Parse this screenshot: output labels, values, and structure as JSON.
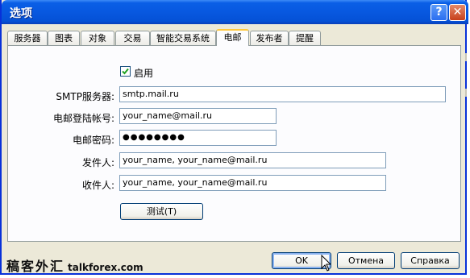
{
  "window": {
    "title": "选项",
    "help_label": "?",
    "close_label": "✕"
  },
  "tabs": [
    {
      "label": "服务器",
      "active": false
    },
    {
      "label": "图表",
      "active": false
    },
    {
      "label": "对象",
      "active": false
    },
    {
      "label": "交易",
      "active": false
    },
    {
      "label": "智能交易系统",
      "active": false
    },
    {
      "label": "电邮",
      "active": true
    },
    {
      "label": "发布者",
      "active": false
    },
    {
      "label": "提醒",
      "active": false
    }
  ],
  "email": {
    "enable_label": "启用",
    "enable_checked": true,
    "smtp_label": "SMTP服务器:",
    "smtp_value": "smtp.mail.ru",
    "login_label": "电邮登陆帐号:",
    "login_value": "your_name@mail.ru",
    "password_label": "电邮密码:",
    "password_value": "●●●●●●●●",
    "from_label": "发件人:",
    "from_value": "your_name, your_name@mail.ru",
    "to_label": "收件人:",
    "to_value": "your_name, your_name@mail.ru",
    "test_button": "测试(T)"
  },
  "footer": {
    "ok_button": "OK",
    "cancel_button": "Отмена",
    "help_button": "Справка",
    "brand_cn": "稿客外汇",
    "brand_en": "talkforex.com"
  }
}
